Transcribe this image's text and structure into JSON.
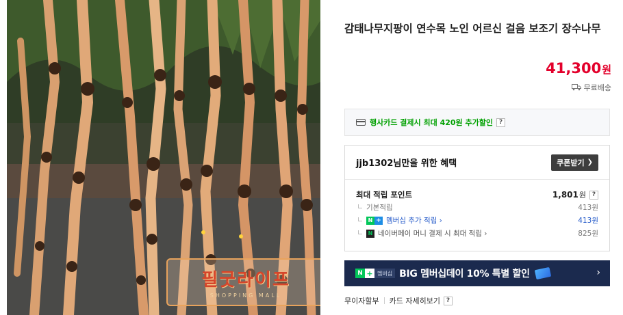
{
  "product": {
    "title": "감태나무지팡이 연수목 노인 어르신 걸음 보조기 장수나무",
    "price": "41,300",
    "price_unit": "원",
    "shipping": "무료배송",
    "image_logo_text": "필굿라이프",
    "image_logo_sub": "SHOPPING MALL"
  },
  "card_discount": {
    "text": "행사카드 결제시 최대 420원 추가할인",
    "help": "?"
  },
  "benefit": {
    "title": "jjb1302님만을 위한 혜택",
    "coupon_button": "쿠폰받기",
    "points_title": "최대 적립 포인트",
    "points_total": "1,801",
    "points_unit": "원",
    "help": "?",
    "rows": [
      {
        "label": "기본적립",
        "value": "413원"
      },
      {
        "label": "멤버십 추가 적립",
        "value": "413원"
      },
      {
        "label": "네이버페이 머니 결제 시 최대 적립",
        "value": "825원"
      }
    ]
  },
  "banner": {
    "badge_label": "멤버십",
    "text_prefix": "BIG 멤버십데이 ",
    "text_highlight": "10% 특별 할인",
    "arrow": "›"
  },
  "bottom_links": {
    "installment": "무이자할부",
    "card_info": "카드 자세히보기",
    "help": "?"
  },
  "colors": {
    "price": "#e3002b",
    "green": "#00a000",
    "banner_bg": "#1b2a4e",
    "link_blue": "#1f56c8"
  }
}
